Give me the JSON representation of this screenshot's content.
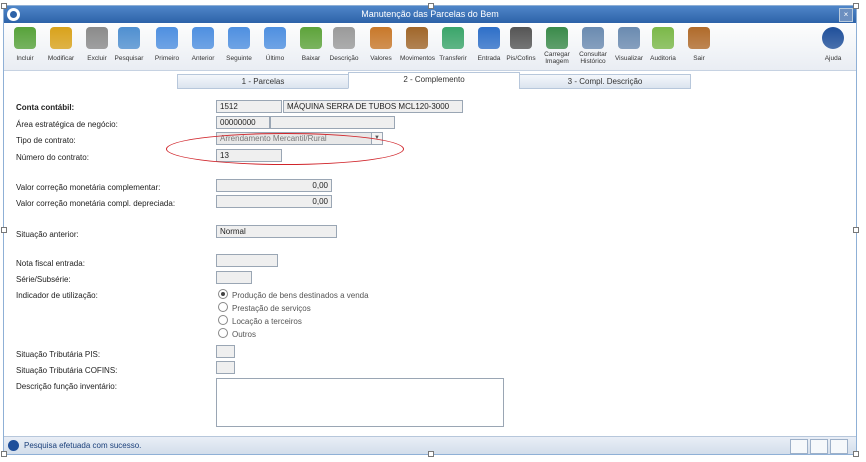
{
  "window": {
    "title": "Manutenção das Parcelas do Bem",
    "close_glyph": "×"
  },
  "toolbar": [
    {
      "id": "incluir",
      "label": "Incluir",
      "icon": "add-icon",
      "color": "#57a23a"
    },
    {
      "id": "modificar",
      "label": "Modificar",
      "icon": "edit-icon",
      "color": "#d9a21b"
    },
    {
      "id": "excluir",
      "label": "Excluir",
      "icon": "trash-icon",
      "color": "#8a8a8a"
    },
    {
      "id": "pesquisar",
      "label": "Pesquisar",
      "icon": "search-icon",
      "color": "#4f8fd0"
    },
    {
      "id": "primeiro",
      "label": "Primeiro",
      "icon": "first-icon",
      "color": "#4e8fe0"
    },
    {
      "id": "anterior",
      "label": "Anterior",
      "icon": "previous-icon",
      "color": "#4e8fe0"
    },
    {
      "id": "seguinte",
      "label": "Seguinte",
      "icon": "next-icon",
      "color": "#4e8fe0"
    },
    {
      "id": "ultimo",
      "label": "Último",
      "icon": "last-icon",
      "color": "#4e8fe0"
    },
    {
      "id": "baixar",
      "label": "Baixar",
      "icon": "download-icon",
      "color": "#5da33a"
    },
    {
      "id": "descricao",
      "label": "Descrição",
      "icon": "description-icon",
      "color": "#9a9a9a"
    },
    {
      "id": "valores",
      "label": "Valores",
      "icon": "money-bag-icon",
      "color": "#c8782a"
    },
    {
      "id": "movimentos",
      "label": "Movimentos",
      "icon": "book-icon",
      "color": "#a0662a"
    },
    {
      "id": "transferir",
      "label": "Transferir",
      "icon": "transfer-icon",
      "color": "#3aa56a"
    },
    {
      "id": "entrada",
      "label": "Entrada",
      "icon": "entry-icon",
      "color": "#2e6fc8"
    },
    {
      "id": "pis_cofins",
      "label": "Pis/Cofins",
      "icon": "calendar-icon",
      "color": "#555555"
    },
    {
      "id": "carregar_imagem",
      "label": "Carregar Imagem",
      "icon": "image-icon",
      "color": "#3a8a4a"
    },
    {
      "id": "consultar_historico",
      "label": "Consultar Histórico",
      "icon": "history-icon",
      "color": "#6a8ab0"
    },
    {
      "id": "visualizar",
      "label": "Visualizar",
      "icon": "preview-icon",
      "color": "#6a8ab0"
    },
    {
      "id": "auditoria",
      "label": "Auditoria",
      "icon": "audit-icon",
      "color": "#7bb848"
    },
    {
      "id": "sair",
      "label": "Sair",
      "icon": "exit-door-icon",
      "color": "#b06a2a"
    },
    {
      "id": "ajuda",
      "label": "Ajuda",
      "icon": "help-icon",
      "color": "#1f4f9a"
    }
  ],
  "tabs": [
    {
      "label": "1 - Parcelas",
      "active": false
    },
    {
      "label": "2 - Complemento",
      "active": true
    },
    {
      "label": "3 - Compl. Descrição",
      "active": false
    }
  ],
  "form": {
    "conta_contabil": {
      "label": "Conta contábil:",
      "code": "1512",
      "description": "MÁQUINA SERRA DE TUBOS MCL120-3000"
    },
    "area_estrategica": {
      "label": "Área estratégica de negócio:",
      "code": "00000000",
      "description": ""
    },
    "tipo_contrato": {
      "label": "Tipo de contrato:",
      "value": "Arrendamento Mercantil/Rural",
      "arrow": "▼"
    },
    "numero_contrato": {
      "label": "Número do contrato:",
      "value": "13"
    },
    "valor_correcao_complementar": {
      "label": "Valor correção monetária complementar:",
      "value": "0,00"
    },
    "valor_correcao_depreciada": {
      "label": "Valor correção monetária compl. depreciada:",
      "value": "0,00"
    },
    "situacao_anterior": {
      "label": "Situação anterior:",
      "value": "Normal"
    },
    "nota_fiscal": {
      "label": "Nota fiscal entrada:",
      "value": ""
    },
    "serie": {
      "label": "Série/Subsérie:",
      "value": ""
    },
    "indicador_utilizacao": {
      "label": "Indicador de utilização:",
      "options": [
        {
          "label": "Produção de bens destinados a venda",
          "selected": true
        },
        {
          "label": "Prestação de serviços",
          "selected": false
        },
        {
          "label": "Locação a terceiros",
          "selected": false
        },
        {
          "label": "Outros",
          "selected": false
        }
      ]
    },
    "situacao_pis": {
      "label": "Situação Tributária PIS:",
      "value": ""
    },
    "situacao_cofins": {
      "label": "Situação Tributária COFINS:",
      "value": ""
    },
    "descricao_funcao": {
      "label": "Descrição função inventário:",
      "value": ""
    }
  },
  "status": {
    "text": "Pesquisa efetuada com sucesso."
  },
  "colors": {
    "title_bar": "#2d62a8",
    "annotation": "#d0242a",
    "status_text": "#1a3f7a"
  }
}
